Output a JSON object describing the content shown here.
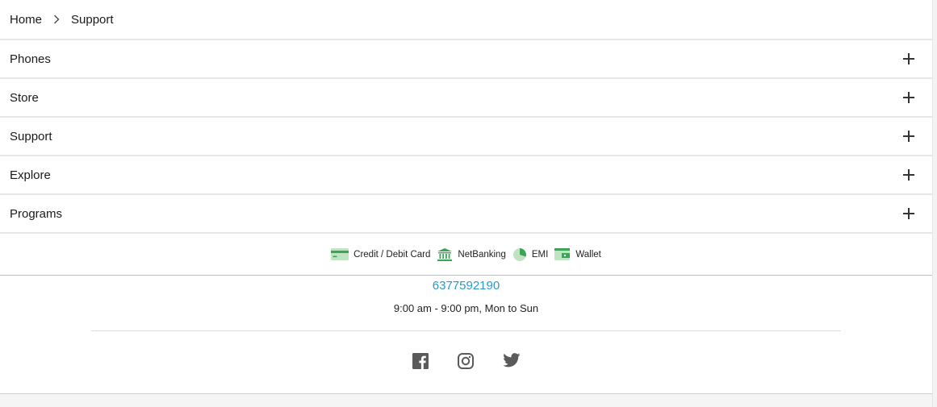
{
  "breadcrumb": {
    "home": "Home",
    "current": "Support"
  },
  "accordion": [
    {
      "label": "Phones"
    },
    {
      "label": "Store"
    },
    {
      "label": "Support"
    },
    {
      "label": "Explore"
    },
    {
      "label": "Programs"
    }
  ],
  "payments": {
    "card": "Credit / Debit Card",
    "netbanking": "NetBanking",
    "emi": "EMI",
    "wallet": "Wallet"
  },
  "contact": {
    "phone": "6377592190",
    "hours": "9:00 am - 9:00 pm, Mon to Sun"
  },
  "social": {
    "facebook": "facebook-icon",
    "instagram": "instagram-icon",
    "twitter": "twitter-icon"
  },
  "colors": {
    "link": "#2a9ac4",
    "payment_icon_green": "#3aa655",
    "payment_icon_light": "#bfe3c3",
    "social_icon": "#5a5a5a",
    "divider": "#e6e6e6"
  }
}
